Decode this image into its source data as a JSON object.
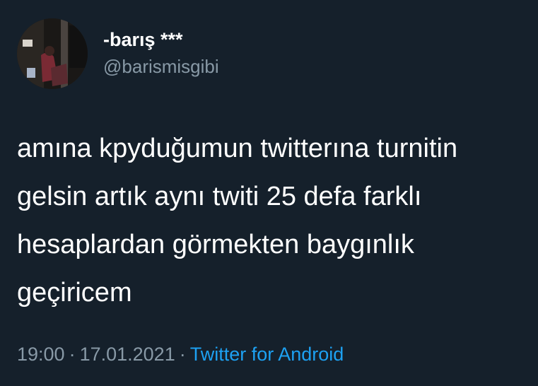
{
  "tweet": {
    "display_name": "-barış ***",
    "handle": "@barismisgibi",
    "text": "amına kpyduğumun twitterına turnitin\ngelsin artık aynı twiti 25 defa farklı\nhesaplardan görmekten baygınlık\ngeçiricem",
    "time": "19:00",
    "separator": "·",
    "date": "17.01.2021",
    "source": "Twitter for Android"
  },
  "colors": {
    "background": "#15202b",
    "text": "#ffffff",
    "secondary_text": "#8899a6",
    "link": "#1da1f2"
  }
}
